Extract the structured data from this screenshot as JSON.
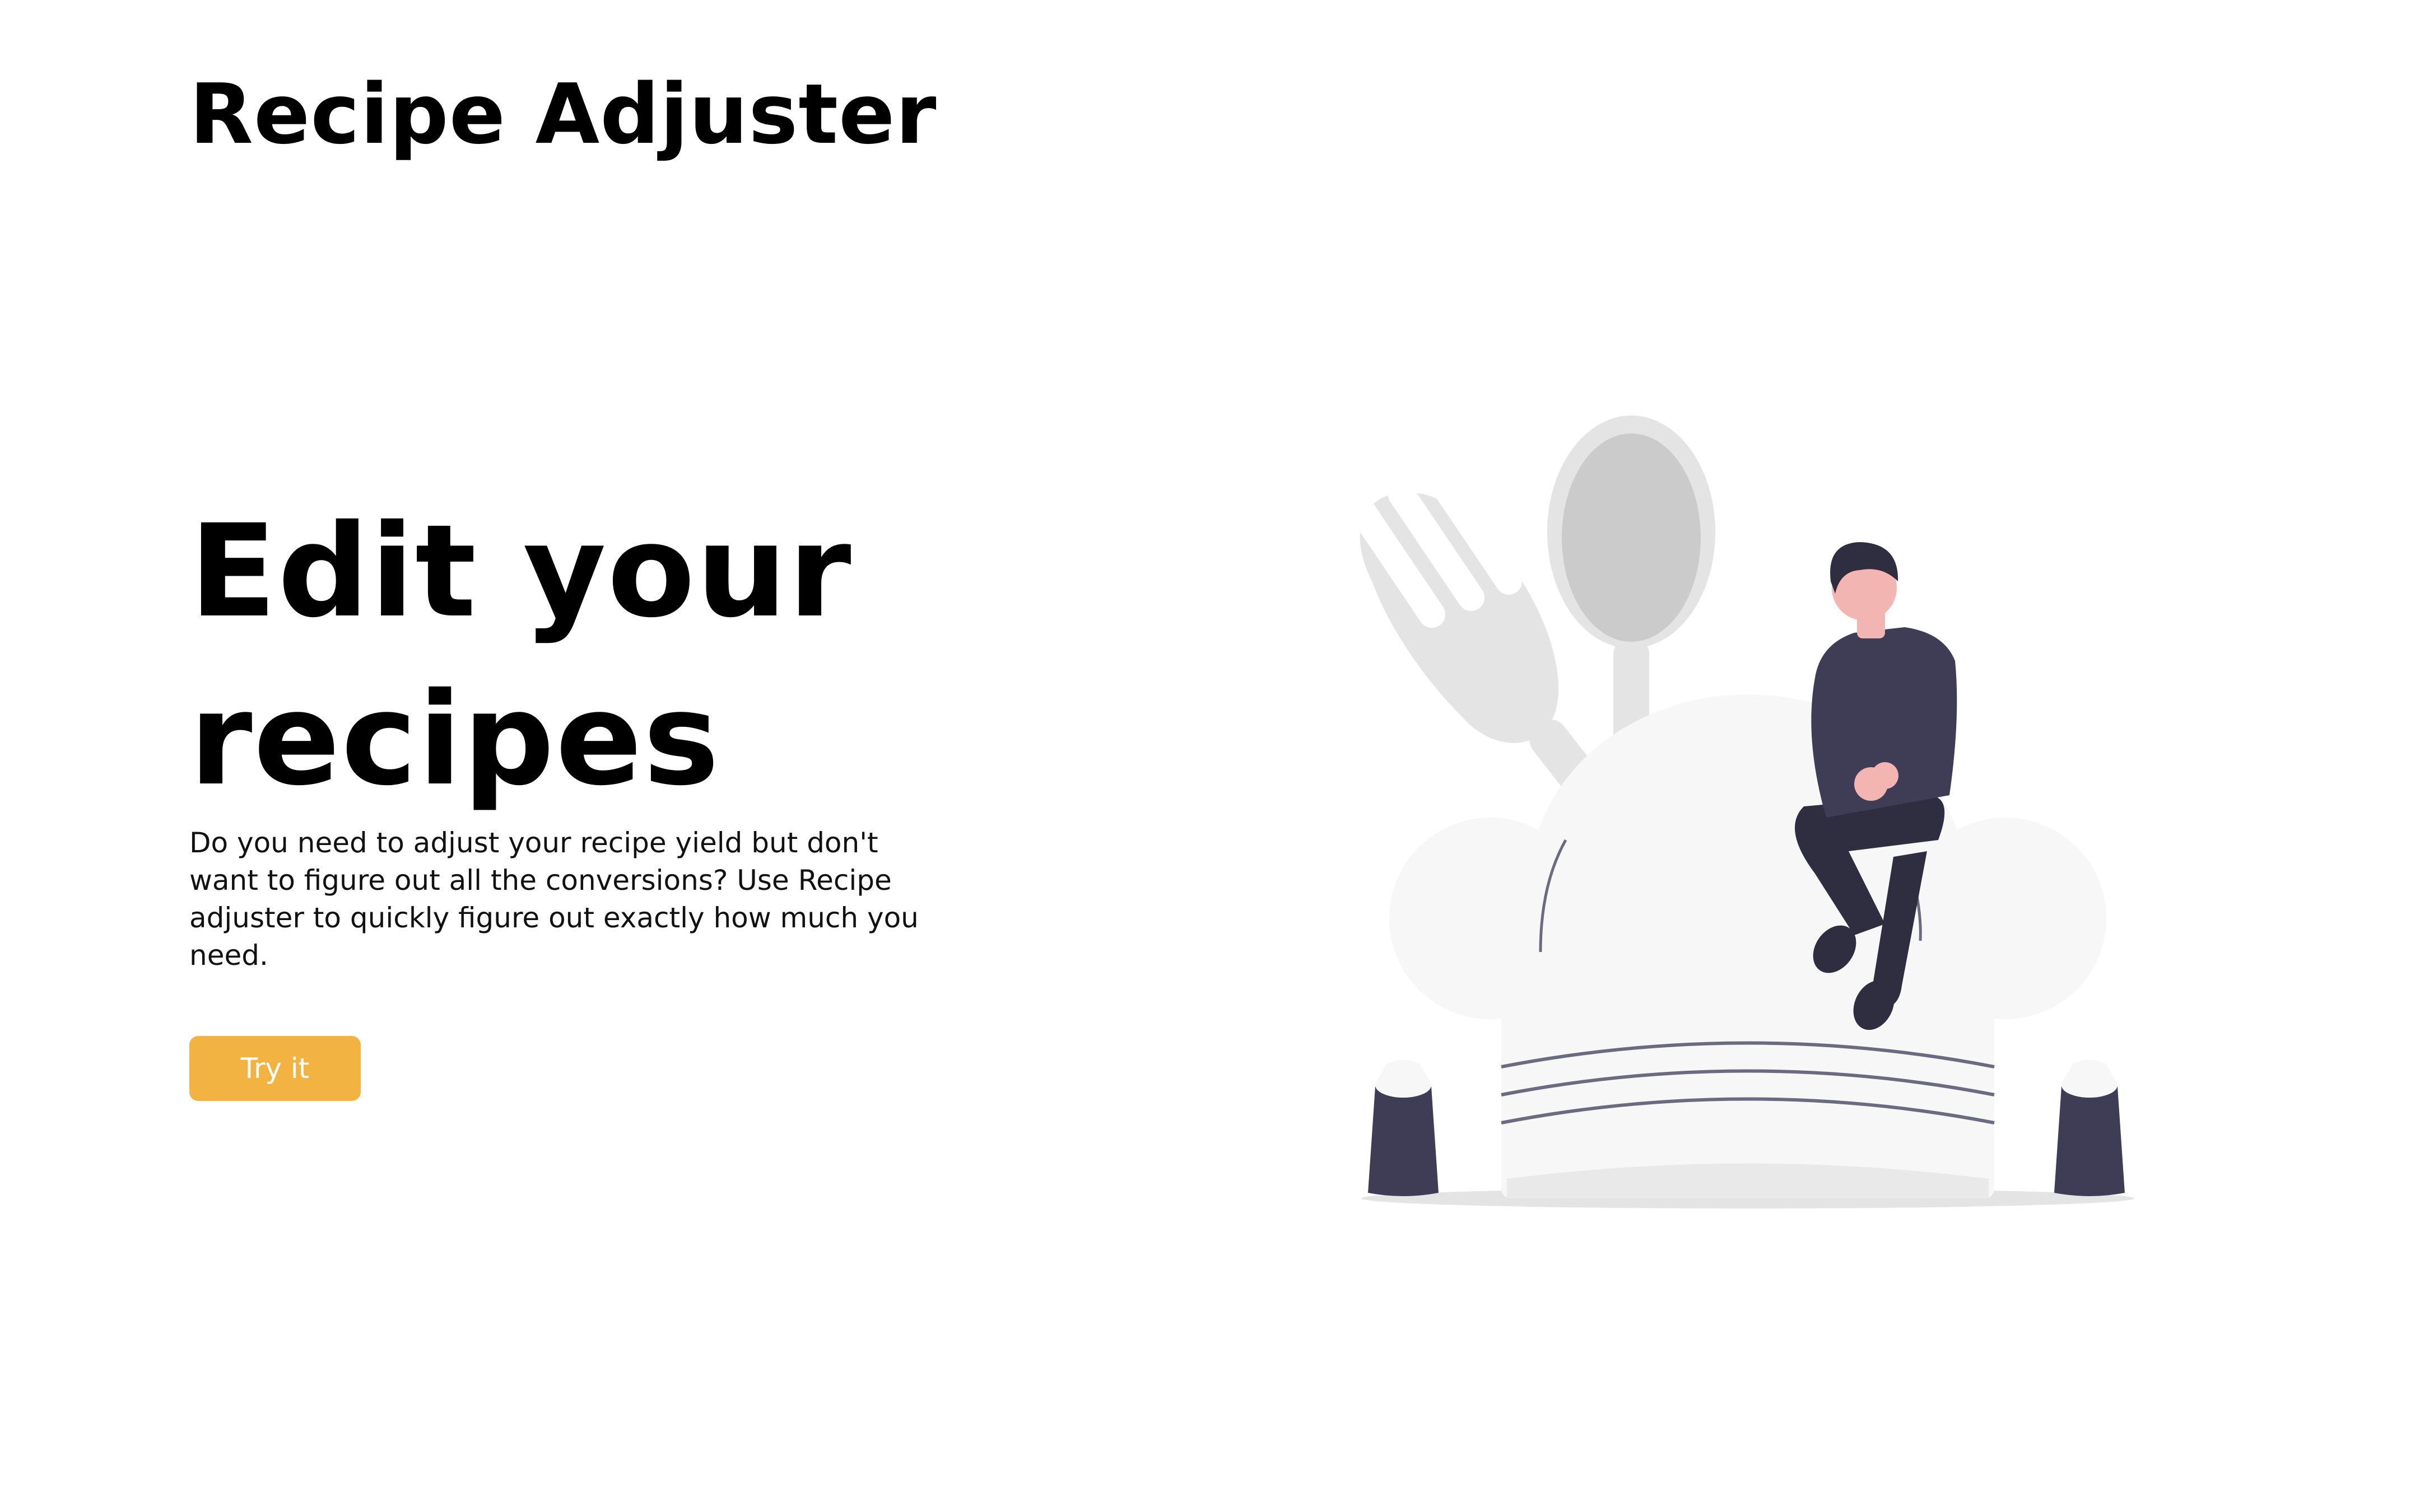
{
  "header": {
    "brand": "Recipe Adjuster"
  },
  "hero": {
    "title": "Edit your recipes",
    "description": "Do you need to adjust your recipe yield but don't want to figure out all the conversions? Use Recipe adjuster to quickly figure out exactly how much you need.",
    "cta_label": "Try it"
  },
  "colors": {
    "accent": "#f2b342",
    "illustration_dark": "#3f3d56",
    "illustration_skin": "#f3b5b2",
    "illustration_light": "#f6f7f6",
    "illustration_gray": "#e4e4e4"
  },
  "illustration": {
    "icon": "chef-hat-with-person-illustration"
  }
}
